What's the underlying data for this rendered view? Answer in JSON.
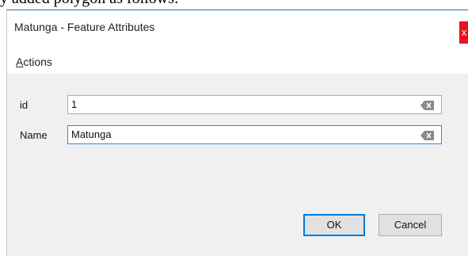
{
  "page": {
    "caption_fragment": "y added polygon as follows:"
  },
  "dialog": {
    "title": "Matunga - Feature Attributes",
    "close_glyph": "x"
  },
  "menu": {
    "actions_label": "Actions"
  },
  "fields": [
    {
      "label": "id",
      "value": "1"
    },
    {
      "label": "Name",
      "value": "Matunga"
    }
  ],
  "buttons": {
    "ok_label": "OK",
    "cancel_label": "Cancel"
  },
  "icons": {
    "clear": "backspace-clear-icon"
  },
  "colors": {
    "accent": "#0078d7",
    "close": "#e81123"
  }
}
